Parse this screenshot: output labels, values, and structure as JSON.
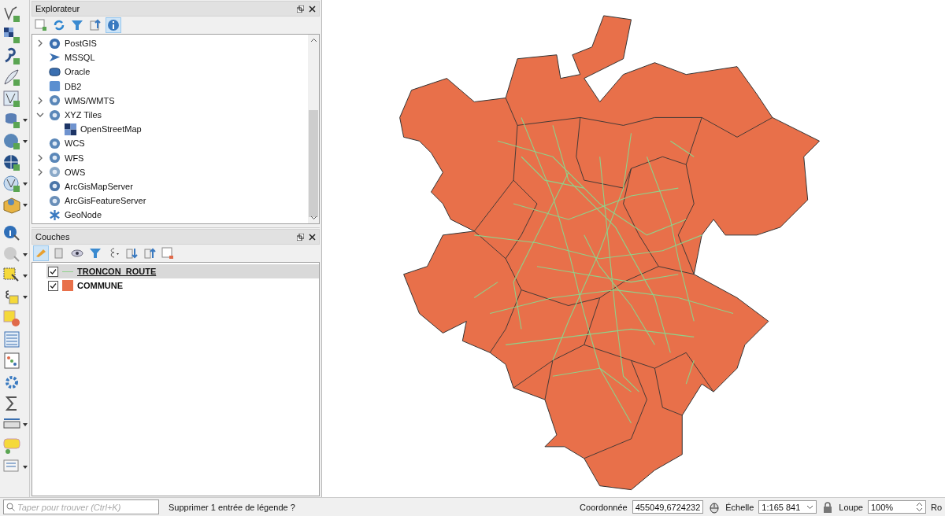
{
  "explorer": {
    "title": "Explorateur",
    "toolbar_buttons": [
      {
        "on": false
      },
      {
        "on": false
      },
      {
        "on": false
      },
      {
        "on": false
      },
      {
        "on": true
      }
    ],
    "items": [
      {
        "label": "PostGIS",
        "expanded": false
      },
      {
        "label": "MSSQL"
      },
      {
        "label": "Oracle"
      },
      {
        "label": "DB2"
      },
      {
        "label": "WMS/WMTS",
        "expanded": false
      },
      {
        "label": "XYZ Tiles",
        "expanded": true,
        "children": [
          {
            "label": "OpenStreetMap"
          }
        ]
      },
      {
        "label": "WCS"
      },
      {
        "label": "WFS",
        "expanded": false
      },
      {
        "label": "OWS",
        "expanded": false
      },
      {
        "label": "ArcGisMapServer"
      },
      {
        "label": "ArcGisFeatureServer"
      },
      {
        "label": "GeoNode"
      }
    ]
  },
  "layers_panel": {
    "title": "Couches",
    "toolbar_buttons": [
      {
        "on": true
      },
      {
        "on": false
      },
      {
        "on": false
      },
      {
        "on": false
      },
      {
        "on": false
      },
      {
        "on": false
      },
      {
        "on": false
      },
      {
        "on": false
      }
    ],
    "layers": [
      {
        "name": "TRONCON_ROUTE",
        "kind": "line",
        "color": "#8fd18a",
        "checked": true,
        "selected": true
      },
      {
        "name": "COMMUNE",
        "kind": "fill",
        "color": "#e8704a",
        "checked": true,
        "selected": false
      }
    ]
  },
  "status_bar": {
    "search": {
      "placeholder": "Taper pour trouver (Ctrl+K)"
    },
    "message": "Supprimer 1 entrée de légende ?",
    "coordinate_label": "Coordonnée",
    "coordinate": "455049,6724232",
    "scale_label": "Échelle",
    "scale": "1:165 841",
    "magnifier_label": "Loupe",
    "magnifier": "100%",
    "rotation_label": "Ro"
  }
}
